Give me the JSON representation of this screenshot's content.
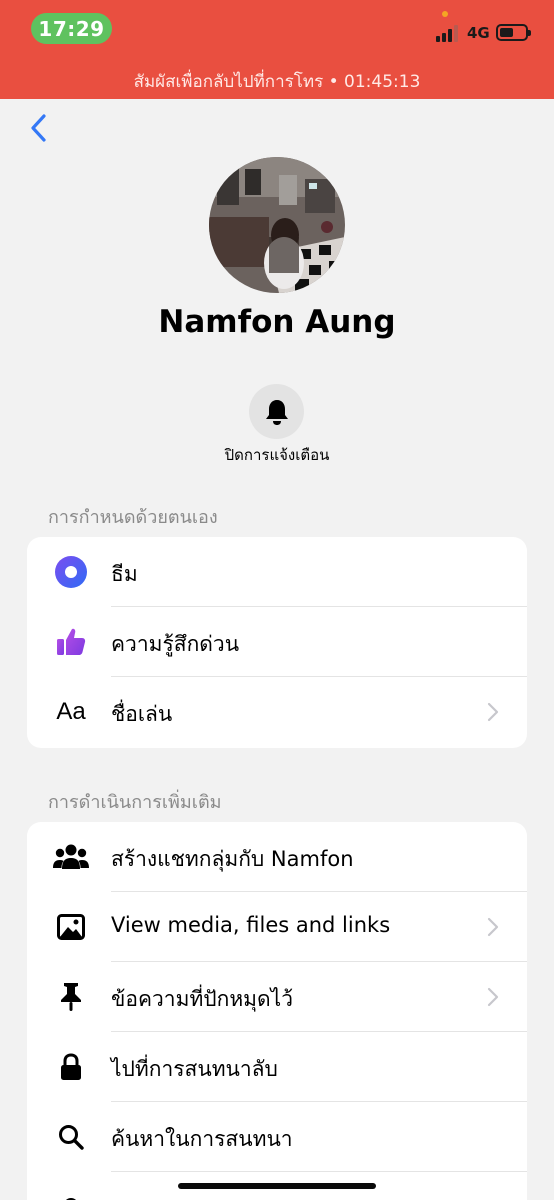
{
  "status": {
    "time": "17:29",
    "network": "4G",
    "return_call": "สัมผัสเพื่อกลับไปที่การโทร • 01:45:13"
  },
  "profile": {
    "name": "Namfon Aung",
    "mute_label": "ปิดการแจ้งเตือน"
  },
  "customize": {
    "title": "การกำหนดด้วยตนเอง",
    "items": [
      {
        "label": "ธีม",
        "icon": "theme-icon"
      },
      {
        "label": "ความรู้สึกด่วน",
        "icon": "thumbs-up-icon"
      },
      {
        "label": "ชื่อเล่น",
        "icon": "nickname-icon",
        "glyph": "Aa"
      }
    ]
  },
  "more_actions": {
    "title": "การดำเนินการเพิ่มเติม",
    "items": [
      {
        "label": "สร้างแชทกลุ่มกับ Namfon",
        "icon": "group-icon"
      },
      {
        "label": "View media, files and links",
        "icon": "image-icon"
      },
      {
        "label": "ข้อความที่ปักหมุดไว้",
        "icon": "pin-icon"
      },
      {
        "label": "ไปที่การสนทนาลับ",
        "icon": "lock-icon"
      },
      {
        "label": "ค้นหาในการสนทนา",
        "icon": "search-icon"
      }
    ]
  },
  "colors": {
    "status_bar": "#e94f40",
    "accent_blue": "#3478f6",
    "theme_gradient": "#5a4cf0",
    "thumb_purple": "#9b3fe0"
  }
}
